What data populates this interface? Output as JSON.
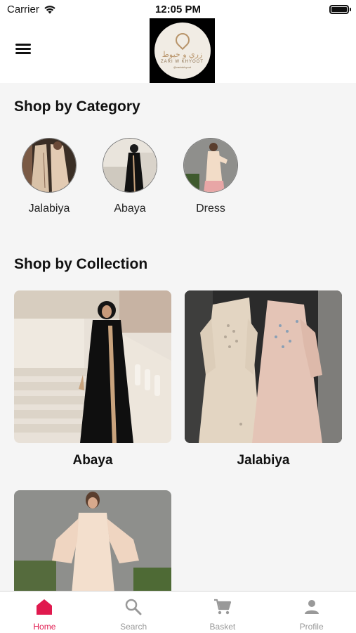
{
  "status_bar": {
    "carrier": "Carrier",
    "time": "12:05 PM"
  },
  "header": {
    "logo": {
      "arabic": "زري و خيوط",
      "latin": "ZARI W KHYOOT",
      "handle": "@zariwkhyoot"
    }
  },
  "categories": {
    "title": "Shop by Category",
    "items": [
      {
        "label": "Jalabiya"
      },
      {
        "label": "Abaya"
      },
      {
        "label": "Dress"
      }
    ]
  },
  "collections": {
    "title": "Shop by Collection",
    "items": [
      {
        "label": "Abaya"
      },
      {
        "label": "Jalabiya"
      },
      {
        "label": ""
      }
    ]
  },
  "tab_bar": {
    "items": [
      {
        "label": "Home",
        "icon": "home-icon",
        "active": true
      },
      {
        "label": "Search",
        "icon": "search-icon",
        "active": false
      },
      {
        "label": "Basket",
        "icon": "cart-icon",
        "active": false
      },
      {
        "label": "Profile",
        "icon": "person-icon",
        "active": false
      }
    ],
    "active_color": "#e0194e",
    "inactive_color": "#999999"
  }
}
